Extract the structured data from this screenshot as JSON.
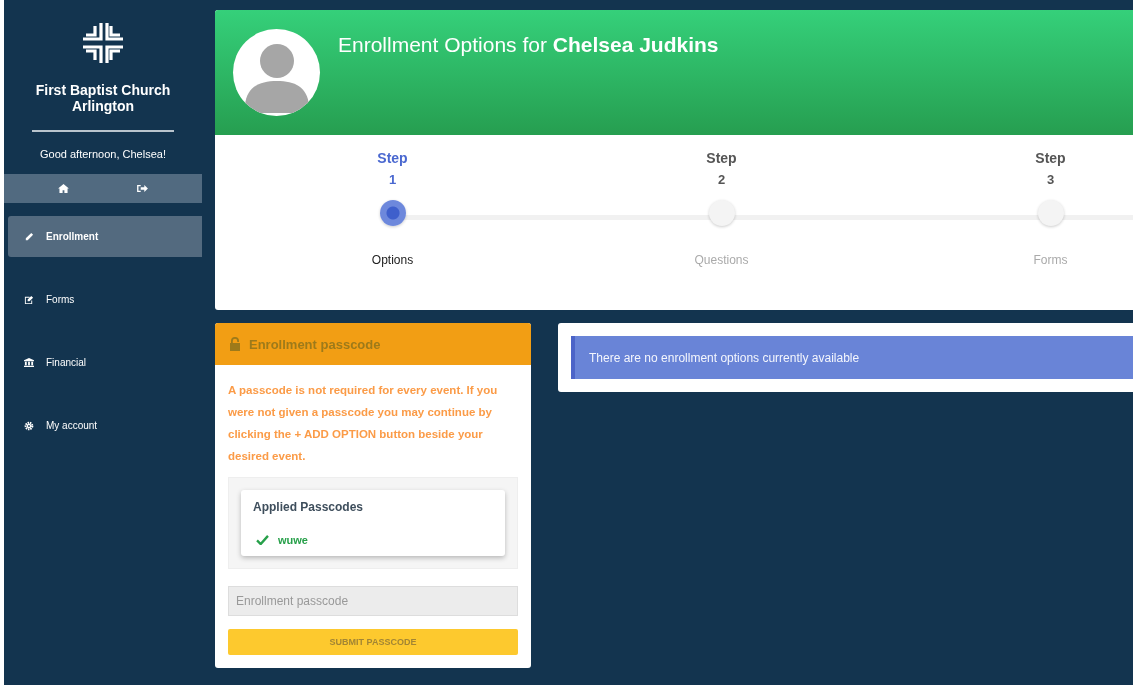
{
  "sidebar": {
    "org_name": "First Baptist Church Arlington",
    "greeting": "Good afternoon, Chelsea!",
    "items": [
      {
        "label": "Enrollment",
        "selected": true
      },
      {
        "label": "Forms",
        "selected": false
      },
      {
        "label": "Financial",
        "selected": false
      },
      {
        "label": "My account",
        "selected": false
      }
    ]
  },
  "header": {
    "title": "Enrollment Options for **Chelsea Judkins**"
  },
  "steps": [
    {
      "label": "Step",
      "number": "1",
      "name": "Options",
      "selected": true
    },
    {
      "label": "Step",
      "number": "2",
      "name": "Questions",
      "selected": false
    },
    {
      "label": "Step",
      "number": "3",
      "name": "Forms",
      "selected": false
    }
  ],
  "passcode_panel": {
    "title": "Enrollment passcode",
    "notice": "A passcode is not required for every event. If you were not given a passcode you may continue by clicking the + ADD OPTION button beside your desired event.",
    "applied_title": "Applied Passcodes",
    "applied": [
      "wuwe"
    ],
    "placeholder": "Enrollment passcode",
    "submit": "SUBMIT PASSCODE"
  },
  "options_panel": {
    "message": "There are no enrollment options currently available"
  }
}
